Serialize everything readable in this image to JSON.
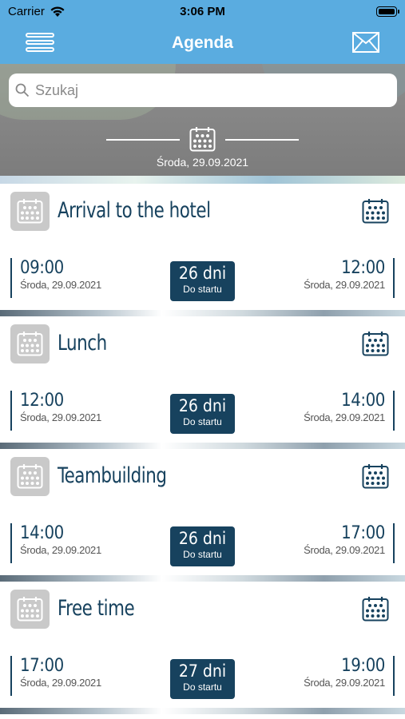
{
  "status": {
    "carrier": "Carrier",
    "time": "3:06 PM"
  },
  "nav": {
    "title": "Agenda",
    "menu_icon": "hamburger-menu-icon",
    "mail_icon": "envelope-icon"
  },
  "search": {
    "placeholder": "Szukaj"
  },
  "date_header": {
    "label": "Środa, 29.09.2021"
  },
  "colors": {
    "nav_bg": "#5aace0",
    "accent": "#17425e",
    "icon_box": "#c9c9c9"
  },
  "events": [
    {
      "title": "Arrival to the hotel",
      "start_time": "09:00",
      "start_date": "Środa, 29.09.2021",
      "days": "26 dni",
      "days_sub": "Do startu",
      "end_time": "12:00",
      "end_date": "Środa, 29.09.2021"
    },
    {
      "title": "Lunch",
      "start_time": "12:00",
      "start_date": "Środa, 29.09.2021",
      "days": "26 dni",
      "days_sub": "Do startu",
      "end_time": "14:00",
      "end_date": "Środa, 29.09.2021"
    },
    {
      "title": "Teambuilding",
      "start_time": "14:00",
      "start_date": "Środa, 29.09.2021",
      "days": "26 dni",
      "days_sub": "Do startu",
      "end_time": "17:00",
      "end_date": "Środa, 29.09.2021"
    },
    {
      "title": "Free time",
      "start_time": "17:00",
      "start_date": "Środa, 29.09.2021",
      "days": "27 dni",
      "days_sub": "Do startu",
      "end_time": "19:00",
      "end_date": "Środa, 29.09.2021"
    }
  ]
}
